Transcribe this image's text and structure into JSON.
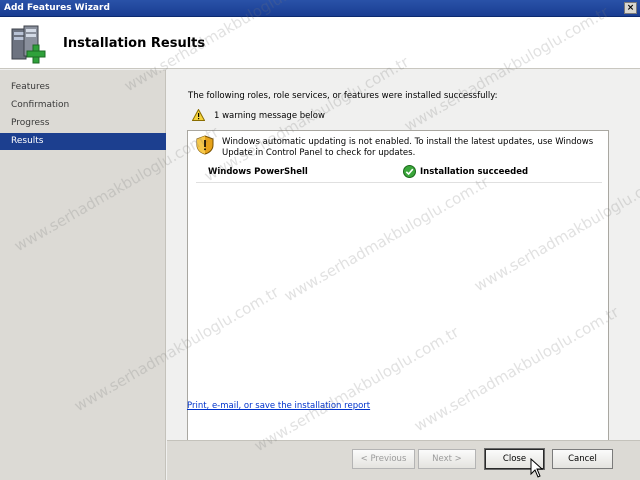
{
  "window": {
    "title": "Add Features Wizard",
    "close_glyph": "×",
    "header_title": "Installation Results"
  },
  "sidebar": {
    "items": [
      {
        "label": "Features"
      },
      {
        "label": "Confirmation"
      },
      {
        "label": "Progress"
      },
      {
        "label": "Results",
        "selected": true
      }
    ]
  },
  "main": {
    "intro_text": "The following roles, role services, or features were installed successfully:",
    "warning_summary": "1 warning message below",
    "result": {
      "message": "Windows automatic updating is not enabled. To install the latest updates, use Windows Update in Control Panel to check for updates.",
      "feature_name": "Windows PowerShell",
      "status": "Installation succeeded"
    },
    "report_link": "Print, e-mail, or save the installation report"
  },
  "buttons": {
    "previous": "< Previous",
    "next": "Next >",
    "close": "Close",
    "cancel": "Cancel"
  },
  "watermark": {
    "text": "www.serhadmakbuloglu.com.tr"
  },
  "colors": {
    "title_bar": "#1a3d92",
    "selected_item": "#1c3f8f",
    "link": "#0033cc"
  }
}
